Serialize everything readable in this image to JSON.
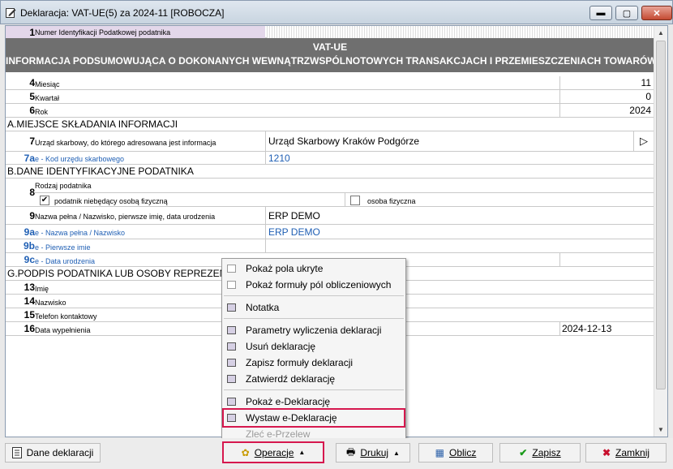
{
  "window": {
    "title": "Deklaracja: VAT-UE(5) za 2024-11   [ROBOCZA]",
    "min_glyph": "▬",
    "max_glyph": "▢",
    "close_glyph": "✕"
  },
  "header": {
    "row1_num": "1",
    "row1_label": "Numer Identyfikacji Podatkowej podatnika",
    "banner_title": "VAT-UE",
    "banner_subtitle": "INFORMACJA PODSUMOWUJĄCA O DOKONANYCH WEWNĄTRZWSPÓLNOTOWYCH TRANSAKCJACH I PRZEMIESZCZENIACH TOWARÓW W"
  },
  "period": [
    {
      "num": "4",
      "label": "Miesiąc",
      "value": "11"
    },
    {
      "num": "5",
      "label": "Kwartał",
      "value": "0"
    },
    {
      "num": "6",
      "label": "Rok",
      "value": "2024"
    }
  ],
  "section_a": {
    "title": "A.MIEJSCE SKŁADANIA INFORMACJI",
    "row7_num": "7",
    "row7_label": "Urząd skarbowy, do którego adresowana jest informacja",
    "row7_value": "Urząd Skarbowy Kraków Podgórze",
    "row7_button": "▷",
    "row7a_num": "7a",
    "row7a_label": "e - Kod urzędu skarbowego",
    "row7a_value": "1210"
  },
  "section_b": {
    "title": "B.DANE IDENTYFIKACYJNE PODATNIKA",
    "row8_num": "8",
    "row8_label": "Rodzaj podatnika",
    "opt1_label": "podatnik niebędący osobą fizyczną",
    "opt1_checked": "✔",
    "opt2_label": "osoba fizyczna",
    "row9_num": "9",
    "row9_label": "Nazwa pełna / Nazwisko, pierwsze imię, data urodzenia",
    "row9_value": "ERP DEMO",
    "row9a_num": "9a",
    "row9a_label": "e - Nazwa pełna / Nazwisko",
    "row9a_value": "ERP DEMO",
    "row9b_num": "9b",
    "row9b_label": "e - Pierwsze imie",
    "row9c_num": "9c",
    "row9c_label": "e - Data urodzenia"
  },
  "section_g": {
    "title": "G.PODPIS PODATNIKA LUB OSOBY REPREZENTUJ",
    "rows": [
      {
        "num": "13",
        "label": "Imię",
        "value": ""
      },
      {
        "num": "14",
        "label": "Nazwisko",
        "value": ""
      },
      {
        "num": "15",
        "label": "Telefon kontaktowy",
        "value": ""
      },
      {
        "num": "16",
        "label": "Data wypełnienia",
        "value": "2024-12-13"
      }
    ]
  },
  "menu": {
    "items": [
      "Pokaż pola ukryte",
      "Pokaż formuły pól obliczeniowych",
      "Notatka",
      "Parametry wyliczenia deklaracji",
      "Usuń deklarację",
      "Zapisz formuły deklaracji",
      "Zatwierdź deklarację",
      "Pokaż e-Deklarację",
      "Wystaw e-Deklarację",
      "Zleć e-Przelew"
    ]
  },
  "toolbar": {
    "dane": "Dane deklaracji",
    "operacje": "Operacje",
    "drukuj": "Drukuj",
    "oblicz": "Oblicz",
    "zapisz": "Zapisz",
    "zamknij": "Zamknij"
  },
  "colors": {
    "highlight": "#d6184e",
    "blue_text": "#1f5fb4",
    "banner": "#6f6f6f"
  }
}
